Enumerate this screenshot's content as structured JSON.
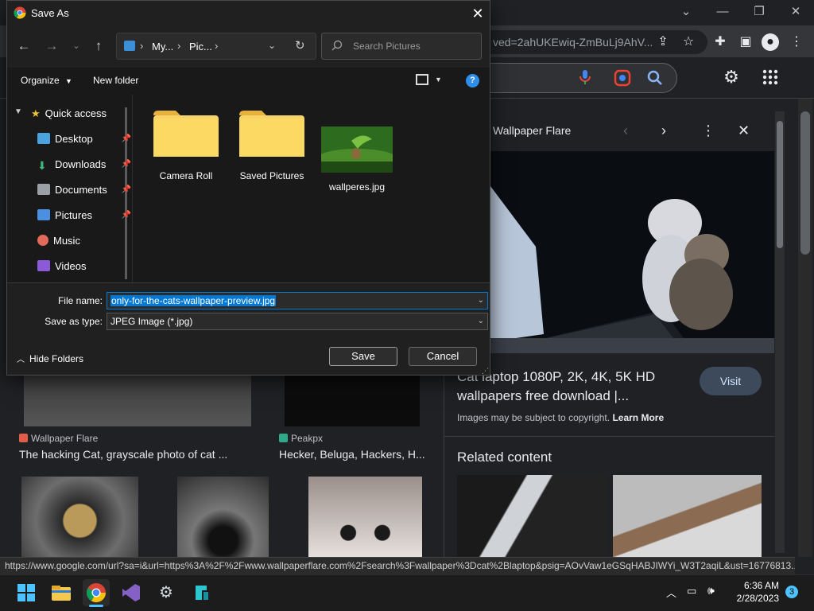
{
  "browser": {
    "omnibox_text": "ved=2ahUKEwiq-ZmBuLj9AhV...",
    "status_url": "https://www.google.com/url?sa=i&url=https%3A%2F%2Fwww.wallpaperflare.com%2Fsearch%3Fwallpaper%3Dcat%2Blaptop&psig=AOvVaw1eGSqHABJIWYi_W3T2aqiL&ust=16776813..."
  },
  "results": [
    {
      "source": "Wallpaper Flare",
      "title": "The hacking Cat, grayscale photo of cat ..."
    },
    {
      "source": "Peakpx",
      "title": "Hecker, Beluga, Hackers, H..."
    }
  ],
  "panel": {
    "source": "Wallpaper Flare",
    "heading": "Cat laptop 1080P, 2K, 4K, 5K HD wallpapers free download |...",
    "visit_label": "Visit",
    "copyright_note": "Images may be subject to copyright.",
    "learn_more": "Learn More",
    "related_title": "Related content"
  },
  "dialog": {
    "title": "Save As",
    "breadcrumb": [
      "My...",
      "Pic..."
    ],
    "search_placeholder": "Search Pictures",
    "organize_label": "Organize",
    "new_folder_label": "New folder",
    "nav": {
      "quick_access": "Quick access",
      "items": [
        {
          "label": "Desktop",
          "pinned": true,
          "icon_color": "#4aa3df"
        },
        {
          "label": "Downloads",
          "pinned": true,
          "icon_color": "#3fb67b"
        },
        {
          "label": "Documents",
          "pinned": true,
          "icon_color": "#9aa0a6"
        },
        {
          "label": "Pictures",
          "pinned": true,
          "icon_color": "#4a90e2"
        },
        {
          "label": "Music",
          "pinned": false,
          "icon_color": "#e26a5a"
        },
        {
          "label": "Videos",
          "pinned": false,
          "icon_color": "#8a5ad8"
        }
      ]
    },
    "files": [
      {
        "label": "Camera Roll",
        "type": "folder"
      },
      {
        "label": "Saved Pictures",
        "type": "folder"
      },
      {
        "label": "wallperes.jpg",
        "type": "image"
      }
    ],
    "file_name_label": "File name:",
    "file_name_value": "only-for-the-cats-wallpaper-preview.jpg",
    "save_as_type_label": "Save as type:",
    "save_as_type_value": "JPEG Image (*.jpg)",
    "hide_folders_label": "Hide Folders",
    "save_label": "Save",
    "cancel_label": "Cancel"
  },
  "taskbar": {
    "time": "6:36 AM",
    "date": "2/28/2023",
    "notification_count": "3"
  }
}
